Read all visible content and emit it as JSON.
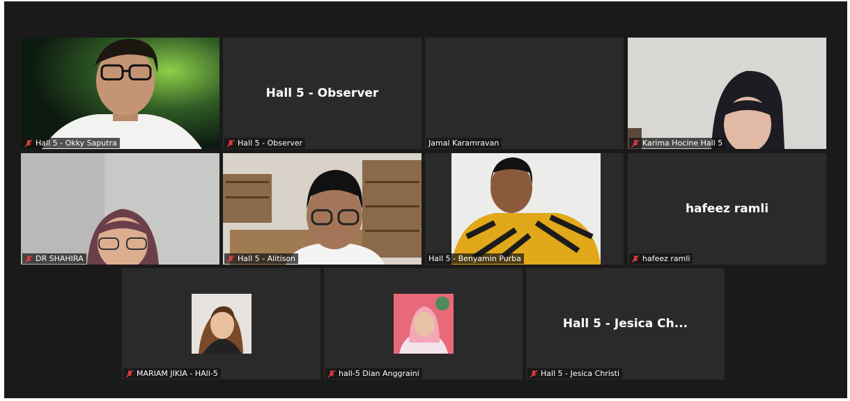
{
  "participants": [
    {
      "label": "Hall 5 - Okky Saputra",
      "mic": "muted"
    },
    {
      "label": "Hall 5 - Observer",
      "display": "Hall 5 - Observer",
      "mic": "muted"
    },
    {
      "label": "Jamal Karamravan",
      "mic": "on"
    },
    {
      "label": "Karima Hocine Hall 5",
      "mic": "muted"
    },
    {
      "label": "DR SHAHIRA",
      "mic": "muted"
    },
    {
      "label": "Hall 5 - Alitison",
      "mic": "muted"
    },
    {
      "label": "Hall 5 - Benyamin Purba",
      "mic": "on",
      "active_speaker": true
    },
    {
      "label": "hafeez ramli",
      "display": "hafeez ramli",
      "mic": "muted"
    },
    {
      "label": "MARIAM JIKIA - HAll-5",
      "mic": "muted"
    },
    {
      "label": "hall-5 Dian Anggraini",
      "mic": "muted"
    },
    {
      "label": "Hall 5 - Jesica Christi",
      "display": "Hall 5 - Jesica Ch...",
      "mic": "muted"
    }
  ],
  "colors": {
    "active_border": "#c6e34a",
    "muted_icon": "#e0393e",
    "tile_bg": "#2a2a2a"
  },
  "icons": {
    "muted": "mic-muted-icon"
  }
}
